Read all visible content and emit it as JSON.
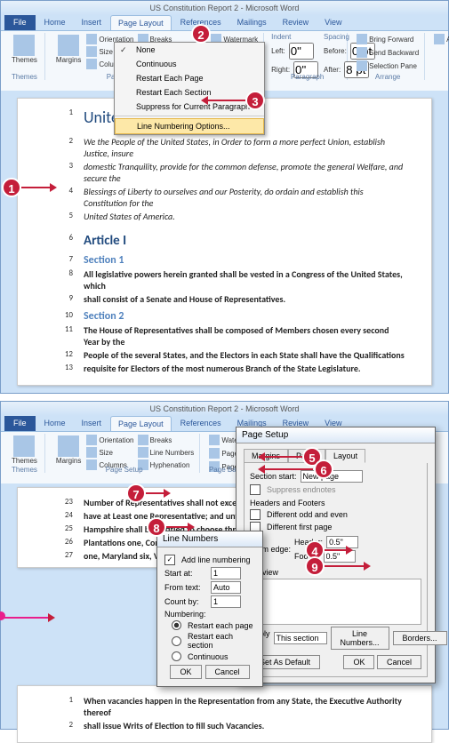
{
  "app": {
    "title": "US Constitution Report 2 - Microsoft Word"
  },
  "tabs": {
    "file": "File",
    "home": "Home",
    "insert": "Insert",
    "pagelayout": "Page Layout",
    "references": "References",
    "mailings": "Mailings",
    "review": "Review",
    "view": "View"
  },
  "ribbon": {
    "themes": "Themes",
    "margins": "Margins",
    "orientation": "Orientation",
    "size": "Size",
    "columns": "Columns",
    "breaks": "Breaks",
    "linenumbers": "Line Numbers",
    "hyphenation": "Hyphenation",
    "pagesetup_label": "Page Setup",
    "watermark": "Watermark",
    "pagecolor": "Page Color",
    "pageborders": "Page Borders",
    "pagebg_label": "Page Background",
    "indent": "Indent",
    "left": "Left:",
    "right": "Right:",
    "left_val": "0\"",
    "right_val": "0\"",
    "spacing": "Spacing",
    "before": "Before:",
    "after": "After:",
    "before_val": "0 pt",
    "after_val": "8 pt",
    "paragraph_label": "Paragraph",
    "bringforward": "Bring Forward",
    "sendbackward": "Send Backward",
    "selectionpane": "Selection Pane",
    "align": "Align",
    "arrange_label": "Arrange"
  },
  "dropdown": {
    "none": "None",
    "continuous": "Continuous",
    "restart_page": "Restart Each Page",
    "restart_section": "Restart Each Section",
    "suppress": "Suppress for Current Paragraph",
    "options": "Line Numbering Options..."
  },
  "doc1": {
    "l1": {
      "n": "1",
      "t": "United     titution"
    },
    "l2": {
      "n": "2",
      "t": "We the People of the United States, in Order to form a more perfect Union, establish Justice, insure"
    },
    "l3": {
      "n": "3",
      "t": "domestic Tranquility, provide for the common defense, promote the general Welfare, and secure the"
    },
    "l4": {
      "n": "4",
      "t": "Blessings of Liberty to ourselves and our Posterity, do ordain and establish this Constitution for the"
    },
    "l5": {
      "n": "5",
      "t": "United States of America."
    },
    "l6": {
      "n": "6",
      "t": "Article I"
    },
    "l7": {
      "n": "7",
      "t": "Section 1"
    },
    "l8": {
      "n": "8",
      "t": "All legislative powers herein granted shall be vested in a Congress of the United States, which"
    },
    "l9": {
      "n": "9",
      "t": "shall consist of a Senate and House of Representatives."
    },
    "l10": {
      "n": "10",
      "t": "Section 2"
    },
    "l11": {
      "n": "11",
      "t": "The House of Representatives shall be composed of Members chosen every second Year by the"
    },
    "l12": {
      "n": "12",
      "t": "People of the several States, and the Electors in each State shall have the Qualifications"
    },
    "l13": {
      "n": "13",
      "t": "requisite for Electors of the most numerous Branch of the State Legislature."
    }
  },
  "doc2": {
    "l23": {
      "n": "23",
      "t": "Number of Representatives shall not exceed one"
    },
    "l24": {
      "n": "24",
      "t": "have at Least one Representative; and until such"
    },
    "l25": {
      "n": "25",
      "t": "Hampshire shall be entitled to choose three, Ma"
    },
    "l26": {
      "n": "26",
      "t": "Plantations one, Connecticut five, New-York six,"
    },
    "l27": {
      "n": "27",
      "t": "one, Maryland six, Virginia ten, North Carolina fi"
    }
  },
  "doc3": {
    "l1": {
      "n": "1",
      "t": "When vacancies happen in the Representation from any State, the Executive Authority thereof"
    },
    "l2": {
      "n": "2",
      "t": "shall issue Writs of Election to fill such Vacancies."
    }
  },
  "pagesetup": {
    "title": "Page Setup",
    "tab_margins": "Margins",
    "tab_paper": "Paper",
    "tab_layout": "Layout",
    "section_start": "Section start:",
    "section_start_val": "New page",
    "suppress_endnotes": "Suppress endnotes",
    "headers_footers": "Headers and Footers",
    "diff_odd_even": "Different odd and even",
    "diff_first": "Different first page",
    "from_edge": "From edge:",
    "header": "Header:",
    "header_val": "0.5\"",
    "footer": "Footer:",
    "footer_val": "0.5\"",
    "preview": "Preview",
    "apply_to": "Apply to:",
    "apply_to_val": "This section",
    "line_numbers_btn": "Line Numbers...",
    "borders_btn": "Borders...",
    "set_default": "Set As Default",
    "ok": "OK",
    "cancel": "Cancel"
  },
  "linenumdlg": {
    "title": "Line Numbers",
    "add": "Add line numbering",
    "start_at": "Start at:",
    "start_at_val": "1",
    "from_text": "From text:",
    "from_text_val": "Auto",
    "count_by": "Count by:",
    "count_by_val": "1",
    "numbering": "Numbering:",
    "restart_page": "Restart each page",
    "restart_section": "Restart each section",
    "continuous": "Continuous",
    "ok": "OK",
    "cancel": "Cancel"
  },
  "callouts": {
    "c1": "1",
    "c2": "2",
    "c3": "3",
    "c4": "4",
    "c5": "5",
    "c6": "6",
    "c7": "7",
    "c8": "8",
    "c9": "9"
  }
}
